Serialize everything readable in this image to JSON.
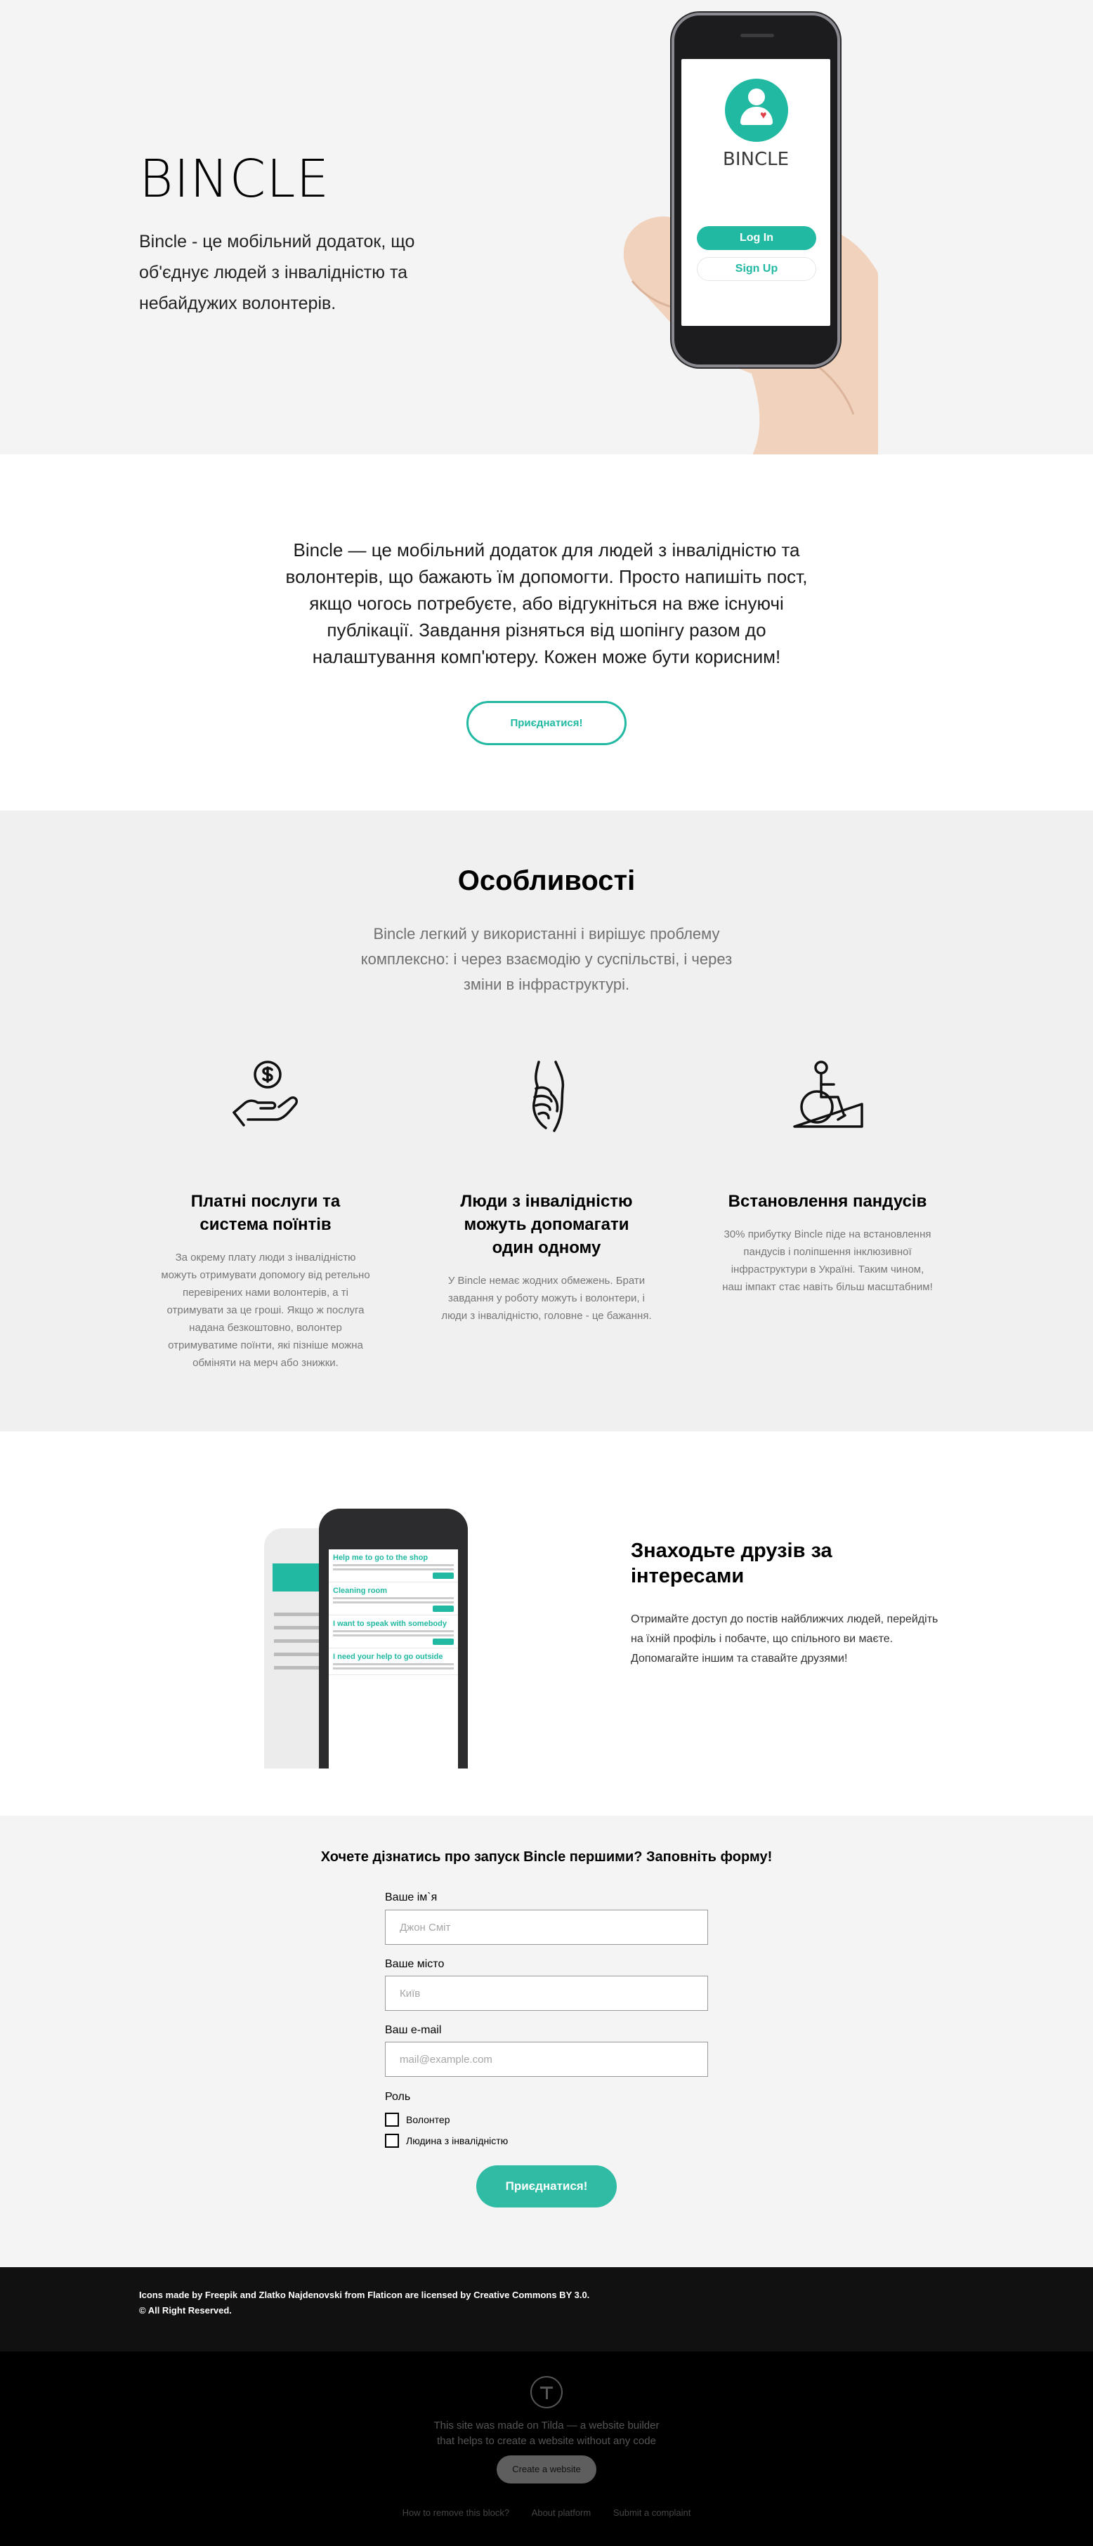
{
  "hero": {
    "title": "BINCLE",
    "subtitle": "Bincle - це мобільний додаток, що об'єднує людей з інвалідністю та небайдужих волонтерів.",
    "app": {
      "name": "BINCLE",
      "login_label": "Log In",
      "signup_label": "Sign Up"
    }
  },
  "about": {
    "text": "Bincle — це мобільний додаток для людей з інвалідністю та волонтерів, що бажають їм допомогти. Просто напишіть пост, якщо чогось потребуєте, або відгукніться на вже існуючі публікації. Завдання різняться від шопінгу разом до налаштування комп'ютеру. Кожен може бути корисним!",
    "button_label": "Приєднатися!"
  },
  "features": {
    "title": "Особливості",
    "subtitle": "Bincle легкий у використанні і вирішує проблему комплексно: і через взаємодію у суспільстві, і через зміни в інфраструктурі.",
    "items": [
      {
        "icon": "money-hand-icon",
        "title": "Платні послуги та система поїнтів",
        "text": "За окрему плату люди з інвалідністю можуть отримувати допомогу від ретельно перевірених нами волонтерів, а ті отримувати за це гроші. Якщо ж послуга надана безкоштовно, волонтер отримуватиме поїнти, які пізніше можна обміняти на мерч або знижки."
      },
      {
        "icon": "handshake-icon",
        "title": "Люди з інвалідністю можуть допомагати один одному",
        "text": "У Bincle немає жодних обмежень. Брати завдання у роботу можуть і волонтери, і люди з інвалідністю, головне - це бажання."
      },
      {
        "icon": "wheelchair-ramp-icon",
        "title": "Встановлення пандусів",
        "text": "30% прибутку Bincle піде на встановлення пандусів і поліпшення інклюзивної інфраструктури в Україні. Таким чином, наш імпакт стає навіть більш масштабним!"
      }
    ]
  },
  "friends": {
    "title": "Знаходьте друзів за інтересами",
    "text": "Отримайте доступ до постів найближчих людей, перейдіть на їхній профіль і побачте, що спільного ви маєте. Допомагайте іншим та ставайте друзями!",
    "posts": [
      "Help me to go to the shop",
      "Cleaning room",
      "I want to speak with somebody",
      "I need your help to go outside"
    ]
  },
  "form": {
    "title": "Хочете дізнатись про запуск Bincle першими? Заповніть форму!",
    "name_label": "Ваше ім`я",
    "name_placeholder": "Джон Сміт",
    "city_label": "Ваше місто",
    "city_placeholder": "Київ",
    "email_label": "Ваш e-mail",
    "email_placeholder": "mail@example.com",
    "role_label": "Роль",
    "roles": [
      "Волонтер",
      "Людина з інвалідністю"
    ],
    "submit_label": "Приєднатися!"
  },
  "credits": {
    "line1": "Icons made by Freepik and Zlatko Najdenovski from Flaticon are licensed by Creative Commons BY 3.0.",
    "line2": "© All Right Reserved."
  },
  "tilda": {
    "text_line1": "This site was made on Tilda — a website builder",
    "text_line2": "that helps to create a website without any code",
    "button_label": "Create a website",
    "links": [
      "How to remove this block?",
      "About platform",
      "Submit a complaint"
    ]
  },
  "colors": {
    "accent": "#21b9a2",
    "hero_bg": "#f4f4f4",
    "features_bg": "#f0f0f0",
    "credits_bg": "#111111",
    "footer_bg": "#000000"
  }
}
